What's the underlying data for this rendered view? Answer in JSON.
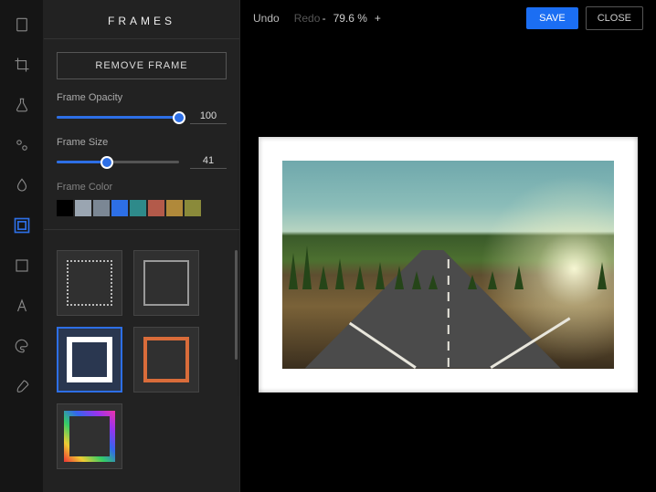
{
  "rail": {
    "tools": [
      "document-icon",
      "crop-icon",
      "flask-icon",
      "adjust-icon",
      "drop-icon",
      "frame-icon",
      "shape-icon",
      "text-icon",
      "palette-icon",
      "brush-icon"
    ],
    "active_index": 5
  },
  "sidebar": {
    "title": "FRAMES",
    "remove_btn": "REMOVE FRAME",
    "opacity": {
      "label": "Frame Opacity",
      "value": 100,
      "max": 100
    },
    "size": {
      "label": "Frame Size",
      "value": 41,
      "max": 100
    },
    "color": {
      "label": "Frame Color",
      "swatches": [
        "#000000",
        "#9aa5b1",
        "#7b8794",
        "#2d6fe6",
        "#2e8a8a",
        "#b35a4a",
        "#b0893a",
        "#8a8a3a"
      ]
    }
  },
  "frames": {
    "items": [
      {
        "style": "dotted",
        "selected": false
      },
      {
        "style": "fancy",
        "selected": false
      },
      {
        "style": "solid-white",
        "selected": true
      },
      {
        "style": "solid-red",
        "selected": false
      },
      {
        "style": "rainbow",
        "selected": false
      }
    ]
  },
  "topbar": {
    "undo": "Undo",
    "redo": "Redo",
    "zoom": {
      "minus": "-",
      "value": "79.6 %",
      "plus": "+"
    },
    "save": "SAVE",
    "close": "CLOSE"
  }
}
